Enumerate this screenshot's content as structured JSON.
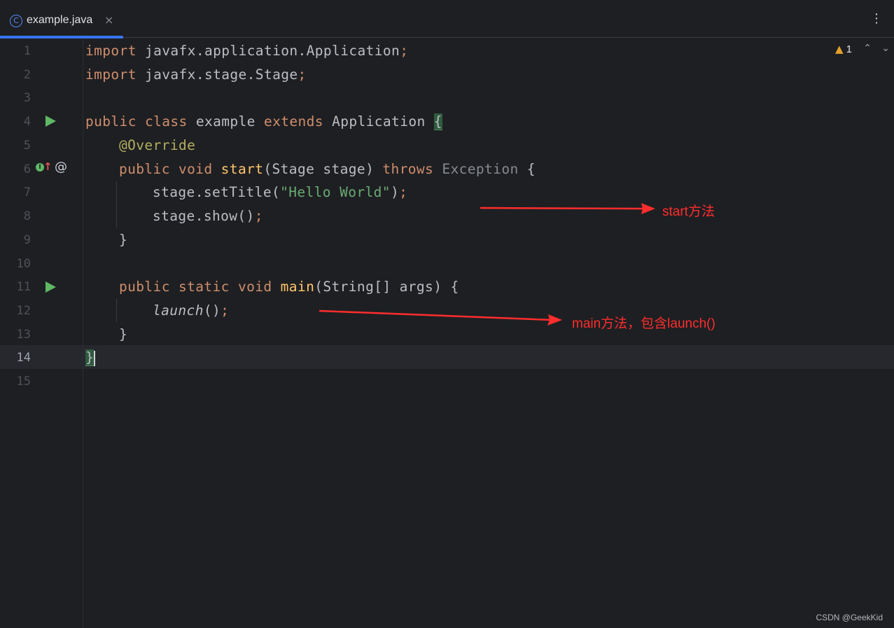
{
  "tab": {
    "icon": "class-icon",
    "icon_glyph": "C",
    "label": "example.java",
    "close": "×"
  },
  "toolbar": {
    "menu_icon": "more-vertical-icon",
    "menu_glyph": "⋮"
  },
  "inspection": {
    "warning_icon": "warning-icon",
    "warning_glyph": "▲",
    "warning_count": "1",
    "nav_up": "⌃",
    "nav_down": "⌄"
  },
  "editor": {
    "current_line": 14,
    "line_numbers": [
      "1",
      "2",
      "3",
      "4",
      "5",
      "6",
      "7",
      "8",
      "9",
      "10",
      "11",
      "12",
      "13",
      "14",
      "15"
    ]
  },
  "code": {
    "l1": {
      "kw": "import",
      "path": " javafx.application.Application",
      "semi": ";"
    },
    "l2": {
      "kw": "import",
      "path": " javafx.stage.Stage",
      "semi": ";"
    },
    "l4": {
      "kw1": "public",
      "kw2": " class",
      "name": " example",
      "kw3": " extends",
      "base": " Application ",
      "brace": "{"
    },
    "l5": {
      "ann": "@Override"
    },
    "l6": {
      "kw1": "public",
      "kw2": " void",
      "fn": " start",
      "params": "(Stage stage) ",
      "kw3": "throws",
      "exc": " Exception",
      "brace": " {"
    },
    "l7": {
      "recv": "stage.setTitle(",
      "str": "\"Hello World\"",
      "close": ")",
      "semi": ";"
    },
    "l8": {
      "recv": "stage.show()",
      "semi": ";"
    },
    "l9": {
      "brace": "}"
    },
    "l11": {
      "kw1": "public",
      "kw2": " static",
      "kw3": " void",
      "fn": " main",
      "params": "(String[] args) {"
    },
    "l12": {
      "call": "launch",
      "parens": "()",
      "semi": ";"
    },
    "l13": {
      "brace": "}"
    },
    "l14": {
      "brace": "}"
    }
  },
  "annotations": {
    "start_note": "start方法",
    "main_note": "main方法，包含launch()",
    "arrow_color": "#ff2d2d"
  },
  "watermark": "CSDN @GeekKid",
  "colors": {
    "background": "#1e1f22",
    "accent": "#3574f0",
    "keyword": "#cf8e6d",
    "string": "#6aab73",
    "annotation": "#b3ae60",
    "method_decl": "#ffc66d"
  }
}
